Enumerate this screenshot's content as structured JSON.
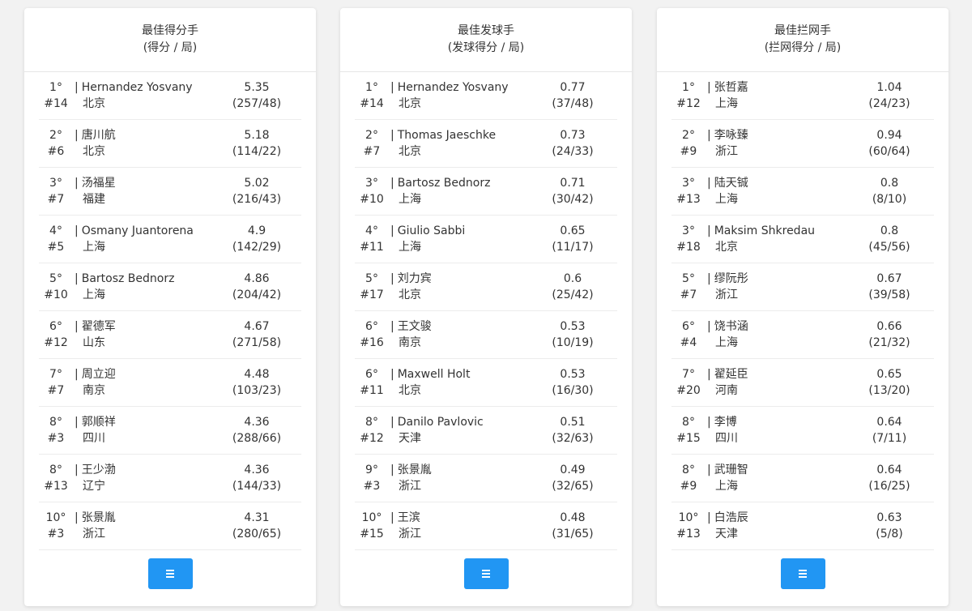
{
  "cards": [
    {
      "title": "最佳得分手",
      "subtitle": "(得分 / 局)",
      "rows": [
        {
          "rank": "1°",
          "number": "#14",
          "name": "Hernandez Yosvany",
          "city": "北京",
          "value": "5.35",
          "detail": "(257/48)"
        },
        {
          "rank": "2°",
          "number": "#6",
          "name": "唐川航",
          "city": "北京",
          "value": "5.18",
          "detail": "(114/22)"
        },
        {
          "rank": "3°",
          "number": "#7",
          "name": "汤福星",
          "city": "福建",
          "value": "5.02",
          "detail": "(216/43)"
        },
        {
          "rank": "4°",
          "number": "#5",
          "name": "Osmany Juantorena",
          "city": "上海",
          "value": "4.9",
          "detail": "(142/29)"
        },
        {
          "rank": "5°",
          "number": "#10",
          "name": "Bartosz Bednorz",
          "city": "上海",
          "value": "4.86",
          "detail": "(204/42)"
        },
        {
          "rank": "6°",
          "number": "#12",
          "name": "翟德军",
          "city": "山东",
          "value": "4.67",
          "detail": "(271/58)"
        },
        {
          "rank": "7°",
          "number": "#7",
          "name": "周立迎",
          "city": "南京",
          "value": "4.48",
          "detail": "(103/23)"
        },
        {
          "rank": "8°",
          "number": "#3",
          "name": "郭顺祥",
          "city": "四川",
          "value": "4.36",
          "detail": "(288/66)"
        },
        {
          "rank": "8°",
          "number": "#13",
          "name": "王少渤",
          "city": "辽宁",
          "value": "4.36",
          "detail": "(144/33)"
        },
        {
          "rank": "10°",
          "number": "#3",
          "name": "张景胤",
          "city": "浙江",
          "value": "4.31",
          "detail": "(280/65)"
        }
      ]
    },
    {
      "title": "最佳发球手",
      "subtitle": "(发球得分 / 局)",
      "rows": [
        {
          "rank": "1°",
          "number": "#14",
          "name": "Hernandez Yosvany",
          "city": "北京",
          "value": "0.77",
          "detail": "(37/48)"
        },
        {
          "rank": "2°",
          "number": "#7",
          "name": "Thomas Jaeschke",
          "city": "北京",
          "value": "0.73",
          "detail": "(24/33)"
        },
        {
          "rank": "3°",
          "number": "#10",
          "name": "Bartosz Bednorz",
          "city": "上海",
          "value": "0.71",
          "detail": "(30/42)"
        },
        {
          "rank": "4°",
          "number": "#11",
          "name": "Giulio Sabbi",
          "city": "上海",
          "value": "0.65",
          "detail": "(11/17)"
        },
        {
          "rank": "5°",
          "number": "#17",
          "name": "刘力宾",
          "city": "北京",
          "value": "0.6",
          "detail": "(25/42)"
        },
        {
          "rank": "6°",
          "number": "#16",
          "name": "王文骏",
          "city": "南京",
          "value": "0.53",
          "detail": "(10/19)"
        },
        {
          "rank": "6°",
          "number": "#11",
          "name": "Maxwell Holt",
          "city": "北京",
          "value": "0.53",
          "detail": "(16/30)"
        },
        {
          "rank": "8°",
          "number": "#12",
          "name": "Danilo Pavlovic",
          "city": "天津",
          "value": "0.51",
          "detail": "(32/63)"
        },
        {
          "rank": "9°",
          "number": "#3",
          "name": "张景胤",
          "city": "浙江",
          "value": "0.49",
          "detail": "(32/65)"
        },
        {
          "rank": "10°",
          "number": "#15",
          "name": "王滨",
          "city": "浙江",
          "value": "0.48",
          "detail": "(31/65)"
        }
      ]
    },
    {
      "title": "最佳拦网手",
      "subtitle": "(拦网得分 / 局)",
      "rows": [
        {
          "rank": "1°",
          "number": "#12",
          "name": "张哲嘉",
          "city": "上海",
          "value": "1.04",
          "detail": "(24/23)"
        },
        {
          "rank": "2°",
          "number": "#9",
          "name": "李咏臻",
          "city": "浙江",
          "value": "0.94",
          "detail": "(60/64)"
        },
        {
          "rank": "3°",
          "number": "#13",
          "name": "陆天铖",
          "city": "上海",
          "value": "0.8",
          "detail": "(8/10)"
        },
        {
          "rank": "3°",
          "number": "#18",
          "name": "Maksim Shkredau",
          "city": "北京",
          "value": "0.8",
          "detail": "(45/56)"
        },
        {
          "rank": "5°",
          "number": "#7",
          "name": "缪阮彤",
          "city": "浙江",
          "value": "0.67",
          "detail": "(39/58)"
        },
        {
          "rank": "6°",
          "number": "#4",
          "name": "饶书涵",
          "city": "上海",
          "value": "0.66",
          "detail": "(21/32)"
        },
        {
          "rank": "7°",
          "number": "#20",
          "name": "翟延臣",
          "city": "河南",
          "value": "0.65",
          "detail": "(13/20)"
        },
        {
          "rank": "8°",
          "number": "#15",
          "name": "李博",
          "city": "四川",
          "value": "0.64",
          "detail": "(7/11)"
        },
        {
          "rank": "8°",
          "number": "#9",
          "name": "武珊智",
          "city": "上海",
          "value": "0.64",
          "detail": "(16/25)"
        },
        {
          "rank": "10°",
          "number": "#13",
          "name": "白浩辰",
          "city": "天津",
          "value": "0.63",
          "detail": "(5/8)"
        }
      ]
    }
  ],
  "colors": {
    "button": "#2196f3",
    "background": "#f2f2f2"
  },
  "icons": {
    "more_button": "list-icon"
  }
}
